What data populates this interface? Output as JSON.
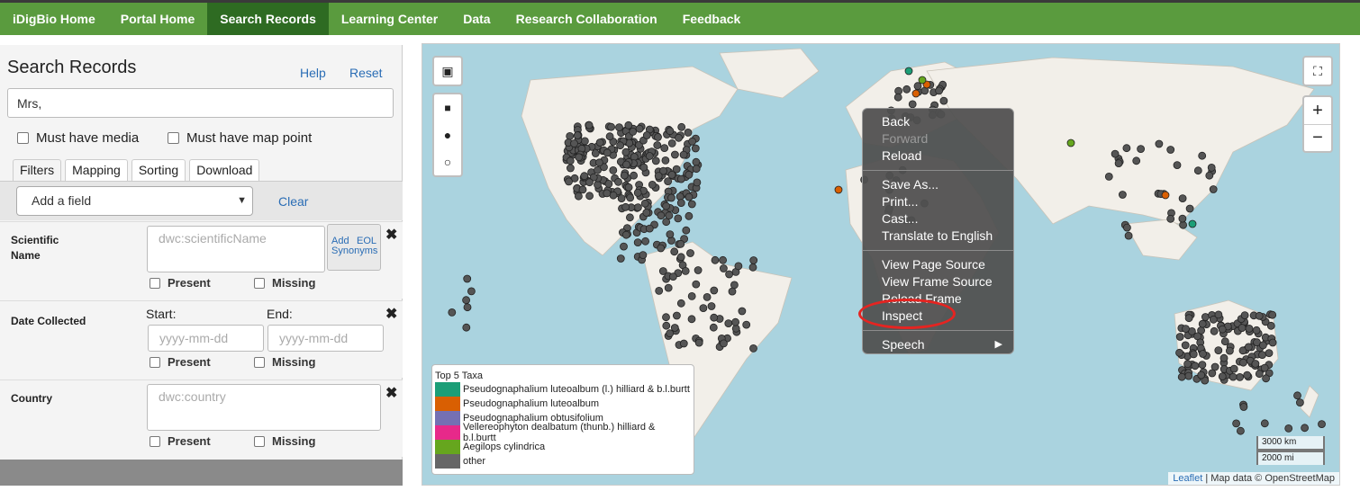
{
  "nav": {
    "items": [
      "iDigBio Home",
      "Portal Home",
      "Search Records",
      "Learning Center",
      "Data",
      "Research Collaboration",
      "Feedback"
    ],
    "active_index": 2
  },
  "panel": {
    "title": "Search Records",
    "help": "Help",
    "reset": "Reset",
    "search_value": "Mrs,",
    "must_have_media": "Must have media",
    "must_have_map_point": "Must have map point",
    "tabs": [
      "Filters",
      "Mapping",
      "Sorting",
      "Download"
    ],
    "add_field": "Add a field",
    "clear": "Clear",
    "filters": {
      "scientific_name": {
        "label": "Scientific Name",
        "placeholder": "dwc:scientificName",
        "add": "Add",
        "eol": "EOL",
        "synonyms": "Synonyms"
      },
      "date_collected": {
        "label": "Date Collected",
        "start": "Start:",
        "end": "End:",
        "start_placeholder": "yyyy-mm-dd",
        "end_placeholder": "yyyy-mm-dd"
      },
      "country": {
        "label": "Country",
        "placeholder": "dwc:country"
      },
      "present": "Present",
      "missing": "Missing"
    }
  },
  "map": {
    "legend": {
      "title": "Top 5 Taxa",
      "items": [
        {
          "label": "Pseudognaphalium luteoalbum (l.) hilliard & b.l.burtt",
          "color": "#1b9e77"
        },
        {
          "label": "Pseudognaphalium luteoalbum",
          "color": "#d95f02"
        },
        {
          "label": "Pseudognaphalium obtusifolium",
          "color": "#7570b3"
        },
        {
          "label": "Vellereophyton dealbatum (thunb.) hilliard & b.l.burtt",
          "color": "#e7298a"
        },
        {
          "label": "Aegilops cylindrica",
          "color": "#66a61e"
        },
        {
          "label": "other",
          "color": "#666666"
        }
      ]
    },
    "scale": {
      "km": "3000 km",
      "mi": "2000 mi"
    },
    "attribution_link": "Leaflet",
    "attribution_rest": "| Map data © OpenStreetMap",
    "zoom_in": "+",
    "zoom_out": "−"
  },
  "context_menu": {
    "groups": [
      [
        {
          "label": "Back"
        },
        {
          "label": "Forward",
          "disabled": true
        },
        {
          "label": "Reload"
        }
      ],
      [
        {
          "label": "Save As..."
        },
        {
          "label": "Print..."
        },
        {
          "label": "Cast..."
        },
        {
          "label": "Translate to English"
        }
      ],
      [
        {
          "label": "View Page Source"
        },
        {
          "label": "View Frame Source"
        },
        {
          "label": "Reload Frame"
        },
        {
          "label": "Inspect"
        }
      ],
      [
        {
          "label": "Speech",
          "submenu_arrow": "▶"
        }
      ]
    ]
  }
}
